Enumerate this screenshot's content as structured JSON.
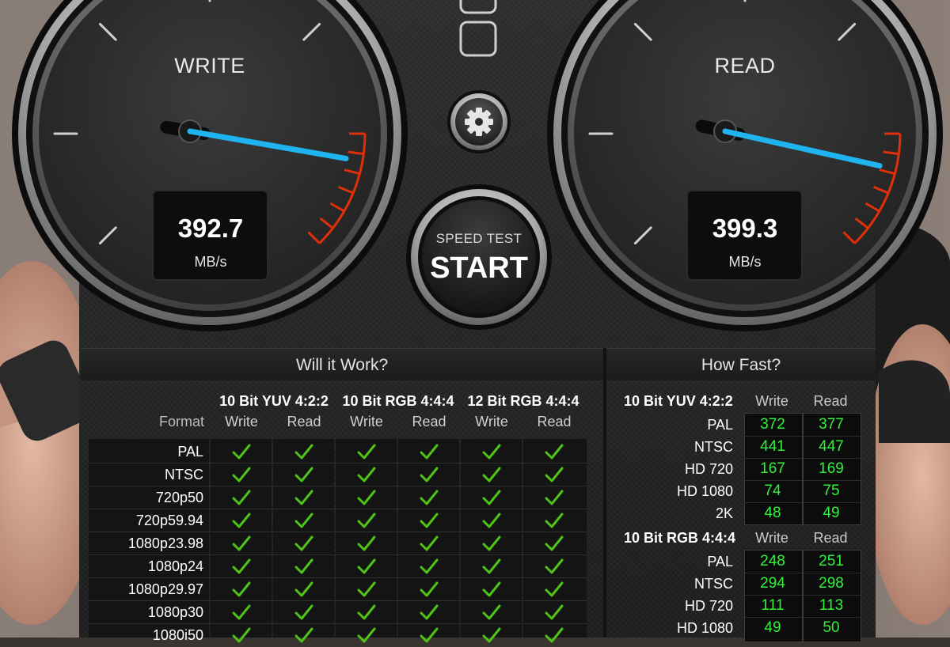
{
  "gauges": {
    "write": {
      "title": "WRITE",
      "value": "392.7",
      "unit": "MB/s",
      "needle_fraction": 0.87
    },
    "read": {
      "title": "READ",
      "value": "399.3",
      "unit": "MB/s",
      "needle_fraction": 0.88
    }
  },
  "start_button": {
    "subtitle": "SPEED TEST",
    "label": "START"
  },
  "settings": {
    "icon": "gear-icon"
  },
  "will_it_work": {
    "title": "Will it Work?",
    "format_header": "Format",
    "groups": [
      {
        "name": "10 Bit YUV 4:2:2",
        "write": "Write",
        "read": "Read"
      },
      {
        "name": "10 Bit RGB 4:4:4",
        "write": "Write",
        "read": "Read"
      },
      {
        "name": "12 Bit RGB 4:4:4",
        "write": "Write",
        "read": "Read"
      }
    ],
    "rows": [
      {
        "format": "PAL"
      },
      {
        "format": "NTSC"
      },
      {
        "format": "720p50"
      },
      {
        "format": "720p59.94"
      },
      {
        "format": "1080p23.98"
      },
      {
        "format": "1080p24"
      },
      {
        "format": "1080p29.97"
      },
      {
        "format": "1080p30"
      },
      {
        "format": "1080i50"
      }
    ],
    "check_icon": "checkmark-icon"
  },
  "how_fast": {
    "title": "How Fast?",
    "sections": [
      {
        "name": "10 Bit YUV 4:2:2",
        "write": "Write",
        "read": "Read",
        "rows": [
          {
            "label": "PAL",
            "write": "372",
            "read": "377"
          },
          {
            "label": "NTSC",
            "write": "441",
            "read": "447"
          },
          {
            "label": "HD 720",
            "write": "167",
            "read": "169"
          },
          {
            "label": "HD 1080",
            "write": "74",
            "read": "75"
          },
          {
            "label": "2K",
            "write": "48",
            "read": "49"
          }
        ]
      },
      {
        "name": "10 Bit RGB 4:4:4",
        "write": "Write",
        "read": "Read",
        "rows": [
          {
            "label": "PAL",
            "write": "248",
            "read": "251"
          },
          {
            "label": "NTSC",
            "write": "294",
            "read": "298"
          },
          {
            "label": "HD 720",
            "write": "111",
            "read": "113"
          },
          {
            "label": "HD 1080",
            "write": "49",
            "read": "50"
          }
        ]
      }
    ]
  },
  "colors": {
    "needle": "#1fb4f0",
    "redline": "#e0300a",
    "check": "#4fc417",
    "fast_values": "#31f23a"
  }
}
